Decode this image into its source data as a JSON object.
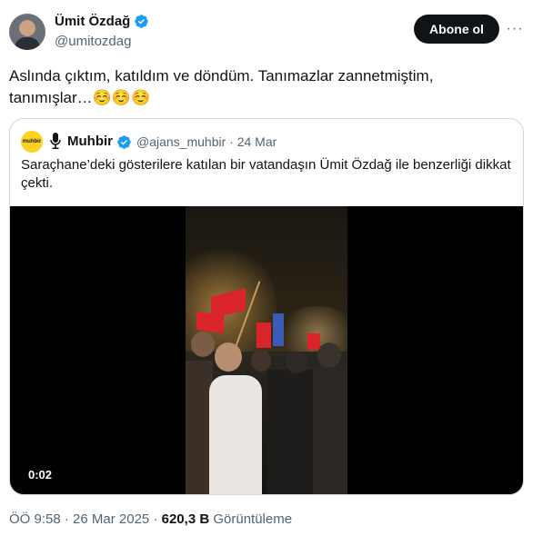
{
  "author": {
    "display_name": "Ümit Özdağ",
    "handle": "@umitozdag",
    "verified": true
  },
  "actions": {
    "follow_label": "Abone ol",
    "more_label": "···"
  },
  "tweet": {
    "text": "Aslında çıktım, katıldım ve döndüm. Tanımazlar zannetmiştim, tanımışlar…",
    "emojis": "☺️☺️☺️"
  },
  "quote": {
    "logo_text": "muhbir",
    "display_name": "Muhbir",
    "handle": "@ajans_muhbir",
    "separator": "·",
    "date": "24 Mar",
    "text": "Saraçhane’deki gösterilere katılan bir vatandaşın Ümit Özdağ ile benzerliği dikkat çekti.",
    "video_duration": "0:02"
  },
  "footer": {
    "time": "ÖÖ 9:58",
    "separator": "·",
    "date": "26 Mar 2025",
    "views_count": "620,3 B",
    "views_label": "Görüntüleme"
  },
  "colors": {
    "verified_blue": "#1d9bf0",
    "follow_bg": "#0f1419",
    "muted_text": "#536471",
    "border": "#cfd9de",
    "logo_yellow": "#ffd21f"
  }
}
